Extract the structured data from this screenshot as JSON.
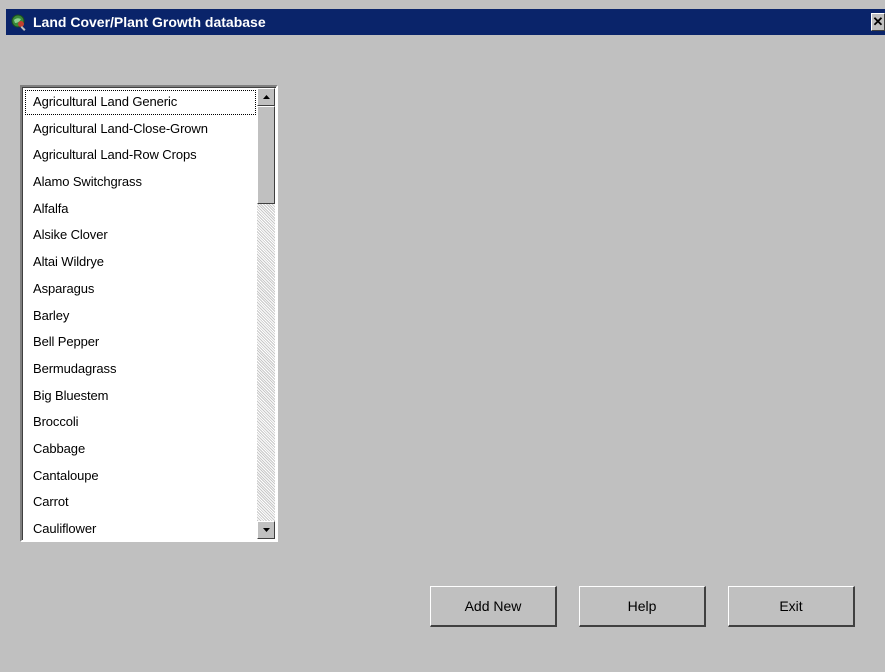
{
  "window": {
    "title": "Land Cover/Plant Growth database",
    "close_label": "✕",
    "colors": {
      "titlebar": "#0a246a",
      "background": "#c0c0c0"
    }
  },
  "list": {
    "items": [
      "Agricultural Land Generic",
      "Agricultural Land-Close-Grown",
      "Agricultural Land-Row Crops",
      "Alamo Switchgrass",
      "Alfalfa",
      "Alsike Clover",
      "Altai Wildrye",
      "Asparagus",
      "Barley",
      "Bell Pepper",
      "Bermudagrass",
      "Big Bluestem",
      "Broccoli",
      "Cabbage",
      "Cantaloupe",
      "Carrot",
      "Cauliflower"
    ],
    "focused_index": 0
  },
  "buttons": {
    "add_new": "Add New",
    "help": "Help",
    "exit": "Exit"
  }
}
